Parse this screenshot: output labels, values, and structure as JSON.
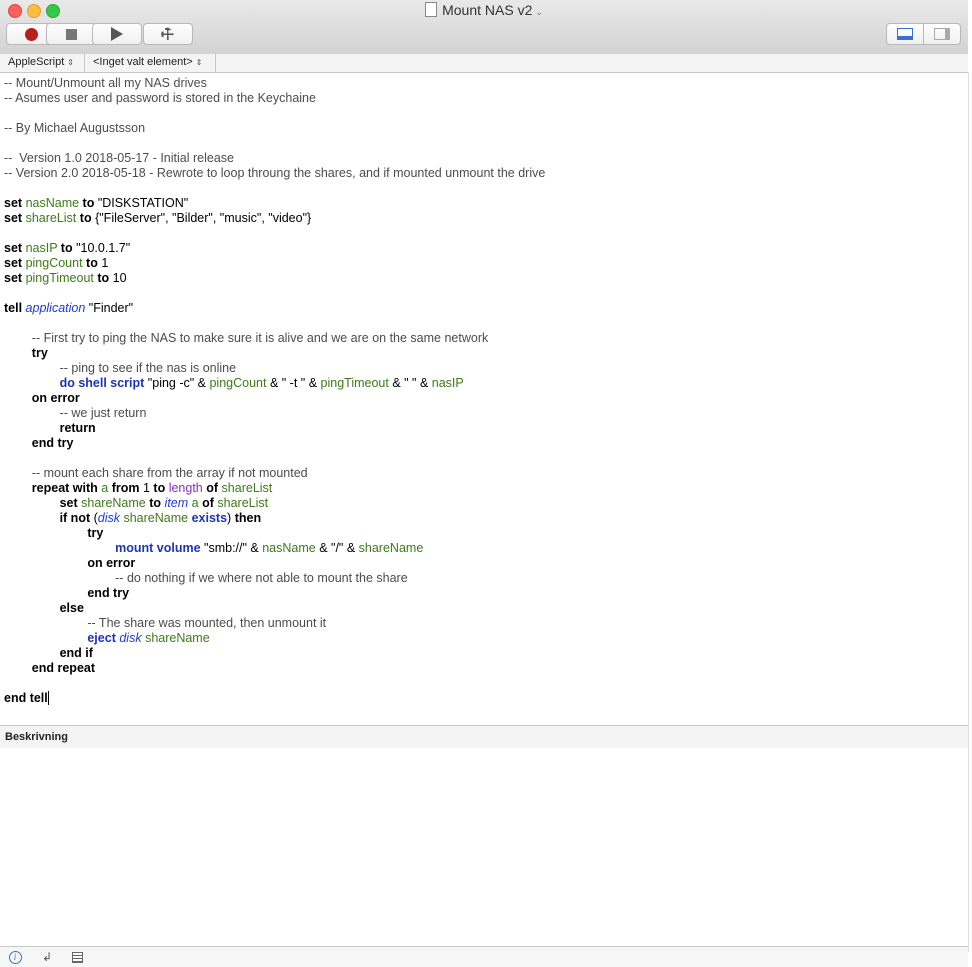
{
  "window": {
    "title": "Mount NAS v2"
  },
  "navbar": {
    "language": "AppleScript",
    "element": "<Inget valt element>"
  },
  "description": {
    "label": "Beskrivning"
  },
  "code": [
    [
      [
        "c",
        "-- Mount/Unmount all my NAS drives"
      ]
    ],
    [
      [
        "c",
        "-- Asumes user and password is stored in the Keychaine"
      ]
    ],
    [],
    [
      [
        "c",
        "-- By Michael Augustsson"
      ]
    ],
    [],
    [
      [
        "c",
        "--  Version 1.0 2018-05-17 - Initial release"
      ]
    ],
    [
      [
        "c",
        "-- Version 2.0 2018-05-18 - Rewrote to loop throung the shares, and if mounted unmount the drive"
      ]
    ],
    [],
    [
      [
        "k",
        "set"
      ],
      [
        "s",
        " "
      ],
      [
        "v",
        "nasName"
      ],
      [
        "s",
        " "
      ],
      [
        "k",
        "to"
      ],
      [
        "s",
        " \"DISKSTATION\""
      ]
    ],
    [
      [
        "k",
        "set"
      ],
      [
        "s",
        " "
      ],
      [
        "v",
        "shareList"
      ],
      [
        "s",
        " "
      ],
      [
        "k",
        "to"
      ],
      [
        "s",
        " {\"FileServer\", \"Bilder\", \"music\", \"video\"}"
      ]
    ],
    [],
    [
      [
        "k",
        "set"
      ],
      [
        "s",
        " "
      ],
      [
        "v",
        "nasIP"
      ],
      [
        "s",
        " "
      ],
      [
        "k",
        "to"
      ],
      [
        "s",
        " \"10.0.1.7\""
      ]
    ],
    [
      [
        "k",
        "set"
      ],
      [
        "s",
        " "
      ],
      [
        "v",
        "pingCount"
      ],
      [
        "s",
        " "
      ],
      [
        "k",
        "to"
      ],
      [
        "s",
        " 1"
      ]
    ],
    [
      [
        "k",
        "set"
      ],
      [
        "s",
        " "
      ],
      [
        "v",
        "pingTimeout"
      ],
      [
        "s",
        " "
      ],
      [
        "k",
        "to"
      ],
      [
        "s",
        " 10"
      ]
    ],
    [],
    [
      [
        "k",
        "tell"
      ],
      [
        "s",
        " "
      ],
      [
        "app",
        "application"
      ],
      [
        "s",
        " \"Finder\""
      ]
    ],
    [],
    [
      [
        "s",
        "        "
      ],
      [
        "c",
        "-- First try to ping the NAS to make sure it is alive and we are on the same network"
      ]
    ],
    [
      [
        "s",
        "        "
      ],
      [
        "k",
        "try"
      ]
    ],
    [
      [
        "s",
        "                "
      ],
      [
        "c",
        "-- ping to see if the nas is online"
      ]
    ],
    [
      [
        "s",
        "                "
      ],
      [
        "b",
        "do shell script"
      ],
      [
        "s",
        " \"ping -c\" & "
      ],
      [
        "v",
        "pingCount"
      ],
      [
        "s",
        " & \" -t \" & "
      ],
      [
        "v",
        "pingTimeout"
      ],
      [
        "s",
        " & \" \" & "
      ],
      [
        "v",
        "nasIP"
      ]
    ],
    [
      [
        "s",
        "        "
      ],
      [
        "k",
        "on error"
      ]
    ],
    [
      [
        "s",
        "                "
      ],
      [
        "c",
        "-- we just return"
      ]
    ],
    [
      [
        "s",
        "                "
      ],
      [
        "k",
        "return"
      ]
    ],
    [
      [
        "s",
        "        "
      ],
      [
        "k",
        "end try"
      ]
    ],
    [],
    [
      [
        "s",
        "        "
      ],
      [
        "c",
        "-- mount each share from the array if not mounted"
      ]
    ],
    [
      [
        "s",
        "        "
      ],
      [
        "k",
        "repeat with"
      ],
      [
        "s",
        " "
      ],
      [
        "v",
        "a"
      ],
      [
        "s",
        " "
      ],
      [
        "k",
        "from"
      ],
      [
        "s",
        " 1 "
      ],
      [
        "k",
        "to"
      ],
      [
        "s",
        " "
      ],
      [
        "p",
        "length"
      ],
      [
        "s",
        " "
      ],
      [
        "k",
        "of"
      ],
      [
        "s",
        " "
      ],
      [
        "v",
        "shareList"
      ]
    ],
    [
      [
        "s",
        "                "
      ],
      [
        "k",
        "set"
      ],
      [
        "s",
        " "
      ],
      [
        "v",
        "shareName"
      ],
      [
        "s",
        " "
      ],
      [
        "k",
        "to"
      ],
      [
        "s",
        " "
      ],
      [
        "app",
        "item"
      ],
      [
        "s",
        " "
      ],
      [
        "v",
        "a"
      ],
      [
        "s",
        " "
      ],
      [
        "k",
        "of"
      ],
      [
        "s",
        " "
      ],
      [
        "v",
        "shareList"
      ]
    ],
    [
      [
        "s",
        "                "
      ],
      [
        "k",
        "if not"
      ],
      [
        "s",
        " ("
      ],
      [
        "app",
        "disk"
      ],
      [
        "s",
        " "
      ],
      [
        "v",
        "shareName"
      ],
      [
        "s",
        " "
      ],
      [
        "b",
        "exists"
      ],
      [
        "s",
        ") "
      ],
      [
        "k",
        "then"
      ]
    ],
    [
      [
        "s",
        "                        "
      ],
      [
        "k",
        "try"
      ]
    ],
    [
      [
        "s",
        "                                "
      ],
      [
        "b",
        "mount volume"
      ],
      [
        "s",
        " \"smb://\" & "
      ],
      [
        "v",
        "nasName"
      ],
      [
        "s",
        " & \"/\" & "
      ],
      [
        "v",
        "shareName"
      ]
    ],
    [
      [
        "s",
        "                        "
      ],
      [
        "k",
        "on error"
      ]
    ],
    [
      [
        "s",
        "                                "
      ],
      [
        "c",
        "-- do nothing if we where not able to mount the share"
      ]
    ],
    [
      [
        "s",
        "                        "
      ],
      [
        "k",
        "end try"
      ]
    ],
    [
      [
        "s",
        "                "
      ],
      [
        "k",
        "else"
      ]
    ],
    [
      [
        "s",
        "                        "
      ],
      [
        "c",
        "-- The share was mounted, then unmount it"
      ]
    ],
    [
      [
        "s",
        "                        "
      ],
      [
        "b",
        "eject"
      ],
      [
        "s",
        " "
      ],
      [
        "app",
        "disk"
      ],
      [
        "s",
        " "
      ],
      [
        "v",
        "shareName"
      ]
    ],
    [
      [
        "s",
        "                "
      ],
      [
        "k",
        "end if"
      ]
    ],
    [
      [
        "s",
        "        "
      ],
      [
        "k",
        "end repeat"
      ]
    ],
    [],
    [
      [
        "k",
        "end tell"
      ]
    ]
  ]
}
